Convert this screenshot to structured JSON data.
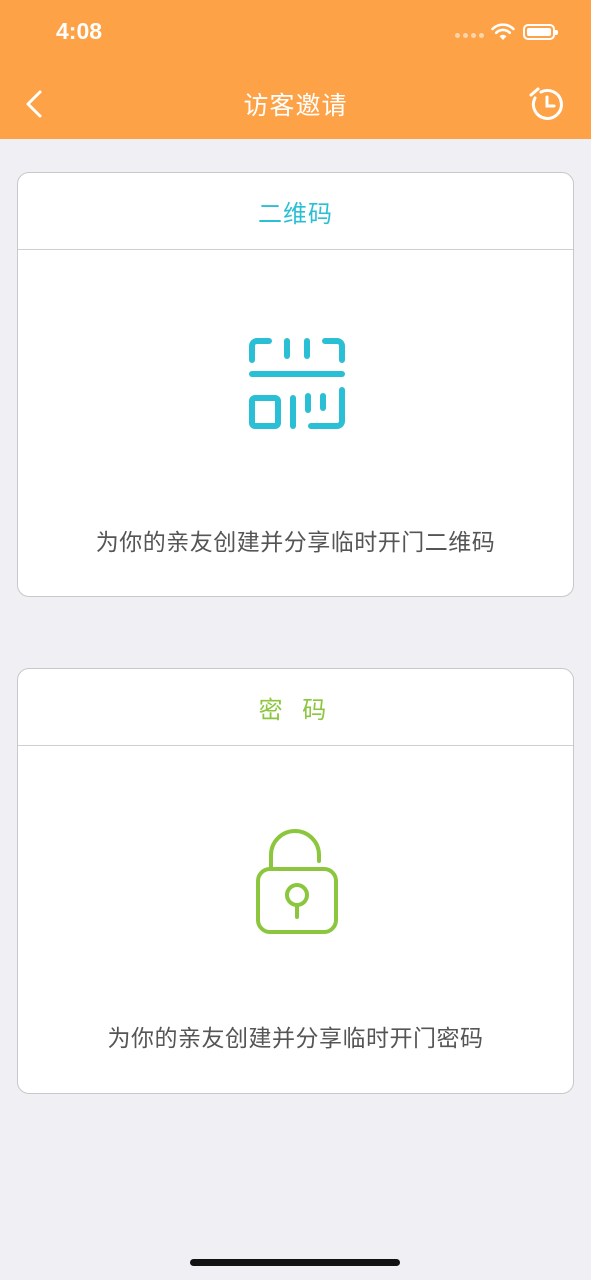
{
  "status_bar": {
    "time": "4:08",
    "icons": [
      "signal-dots-icon",
      "wifi-icon",
      "battery-icon"
    ]
  },
  "nav": {
    "title": "访客邀请",
    "back_icon": "chevron-left-icon",
    "history_icon": "clock-history-icon"
  },
  "cards": [
    {
      "title": "二维码",
      "icon": "qr-scan-icon",
      "description": "为你的亲友创建并分享临时开门二维码",
      "accent": "#2bbfd6"
    },
    {
      "title": "密 码",
      "icon": "padlock-icon",
      "description": "为你的亲友创建并分享临时开门密码",
      "accent": "#8cc63f"
    }
  ],
  "colors": {
    "header": "#fda246",
    "background": "#efeff4",
    "card": "#ffffff",
    "text_secondary": "#555555"
  }
}
